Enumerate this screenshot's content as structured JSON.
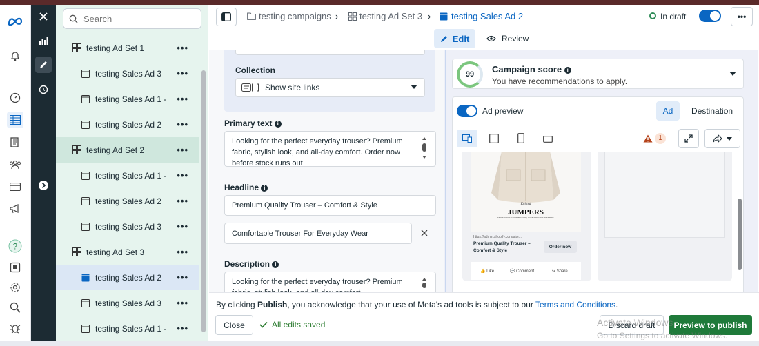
{
  "tree": {
    "search_placeholder": "Search",
    "items": [
      {
        "label": "testing Ad Set 1",
        "kind": "adset"
      },
      {
        "label": "testing Sales Ad 3",
        "kind": "ad"
      },
      {
        "label": "testing Sales Ad 1 -",
        "kind": "ad"
      },
      {
        "label": "testing Sales Ad 2",
        "kind": "ad"
      },
      {
        "label": "testing Ad Set 2",
        "kind": "adset"
      },
      {
        "label": "testing Sales Ad 1 -",
        "kind": "ad"
      },
      {
        "label": "testing Sales Ad 2",
        "kind": "ad"
      },
      {
        "label": "testing Sales Ad 3",
        "kind": "ad"
      },
      {
        "label": "testing Ad Set 3",
        "kind": "adset"
      },
      {
        "label": "testing Sales Ad 2",
        "kind": "ad"
      },
      {
        "label": "testing Sales Ad 3",
        "kind": "ad"
      },
      {
        "label": "testing Sales Ad 1 -",
        "kind": "ad"
      }
    ],
    "more_label": "•••"
  },
  "breadcrumb": {
    "campaign": "testing campaigns",
    "adset": "testing Ad Set 3",
    "ad": "testing Sales Ad 2",
    "status": "In draft",
    "more": "•••"
  },
  "tabs": {
    "edit": "Edit",
    "review": "Review"
  },
  "form": {
    "collection_label": "Collection",
    "collection_value": "Show site links",
    "primary_text_label": "Primary text",
    "primary_text_value": "Looking for the perfect everyday trouser? Premium fabric, stylish look, and all-day comfort. Order now before stock runs out",
    "headline_label": "Headline",
    "headline_1": "Premium Quality Trouser – Comfort & Style",
    "headline_2": "Comfortable Trouser For Everyday Wear",
    "description_label": "Description",
    "description_value": "Looking for the perfect everyday trouser? Premium fabric, stylish look, and all-day comfort"
  },
  "preview": {
    "score": "99",
    "score_title": "Campaign score",
    "score_sub": "You have recommendations to apply.",
    "ad_preview_label": "Ad preview",
    "tab_ad": "Ad",
    "tab_destination": "Destination",
    "warning_count": "1",
    "product_brand_small": "Knitted",
    "product_brand": "JUMPERS",
    "product_tagline": "STYLE YOUR DAY WITH COZY, COMFORTABLE JUMPERS.",
    "link_url": "https://admin.shopify.com/stor...",
    "link_title": "Premium Quality Trouser – Comfort & Style",
    "cta": "Order now",
    "like": "Like",
    "comment": "Comment",
    "share": "Share"
  },
  "footer": {
    "consent_pre": "By clicking ",
    "consent_bold": "Publish",
    "consent_mid": ", you acknowledge that your use of Meta's ad tools is subject to our ",
    "consent_link": "Terms and Conditions",
    "consent_end": ".",
    "close": "Close",
    "saved": "All edits saved",
    "discard": "Discard draft",
    "publish": "Preview to publish",
    "watermark_1": "Activate Windows",
    "watermark_2": "Go to Settings to activate Windows."
  }
}
